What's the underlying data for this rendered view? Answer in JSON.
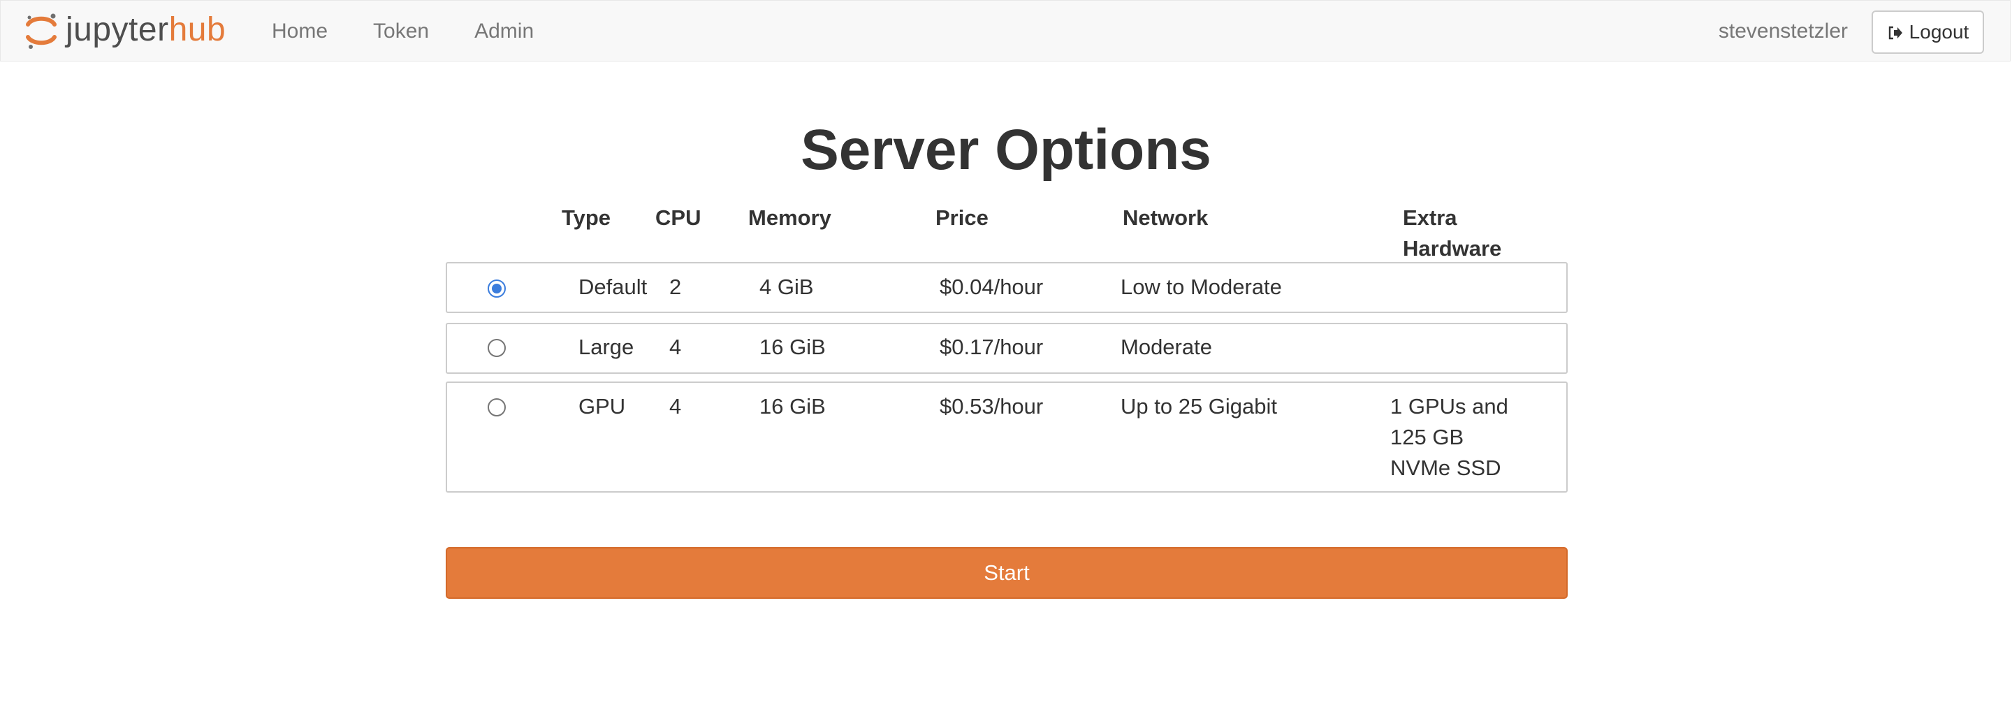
{
  "navbar": {
    "logo": {
      "text_jupyter": "jupyter",
      "text_hub": "hub",
      "brand_color": "#e47b3b"
    },
    "links": [
      {
        "label": "Home"
      },
      {
        "label": "Token"
      },
      {
        "label": "Admin"
      }
    ],
    "username": "stevenstetzler",
    "logout_label": "Logout",
    "logout_icon": "sign-out-icon"
  },
  "main": {
    "title": "Server Options",
    "headers": {
      "type": "Type",
      "cpu": "CPU",
      "memory": "Memory",
      "price": "Price",
      "network": "Network",
      "extra_line1": "Extra",
      "extra_line2": "Hardware"
    },
    "options": [
      {
        "selected": true,
        "type": "Default",
        "cpu": "2",
        "memory": "4 GiB",
        "price": "$0.04/hour",
        "network": "Low to Moderate",
        "extra": []
      },
      {
        "selected": false,
        "type": "Large",
        "cpu": "4",
        "memory": "16 GiB",
        "price": "$0.17/hour",
        "network": "Moderate",
        "extra": []
      },
      {
        "selected": false,
        "type": "GPU",
        "cpu": "4",
        "memory": "16 GiB",
        "price": "$0.53/hour",
        "network": "Up to 25 Gigabit",
        "extra": [
          "1 GPUs and",
          "125 GB",
          "NVMe SSD"
        ]
      }
    ],
    "start_label": "Start",
    "accent_color": "#e47b3b",
    "radio_color": "#3b7ddd"
  }
}
